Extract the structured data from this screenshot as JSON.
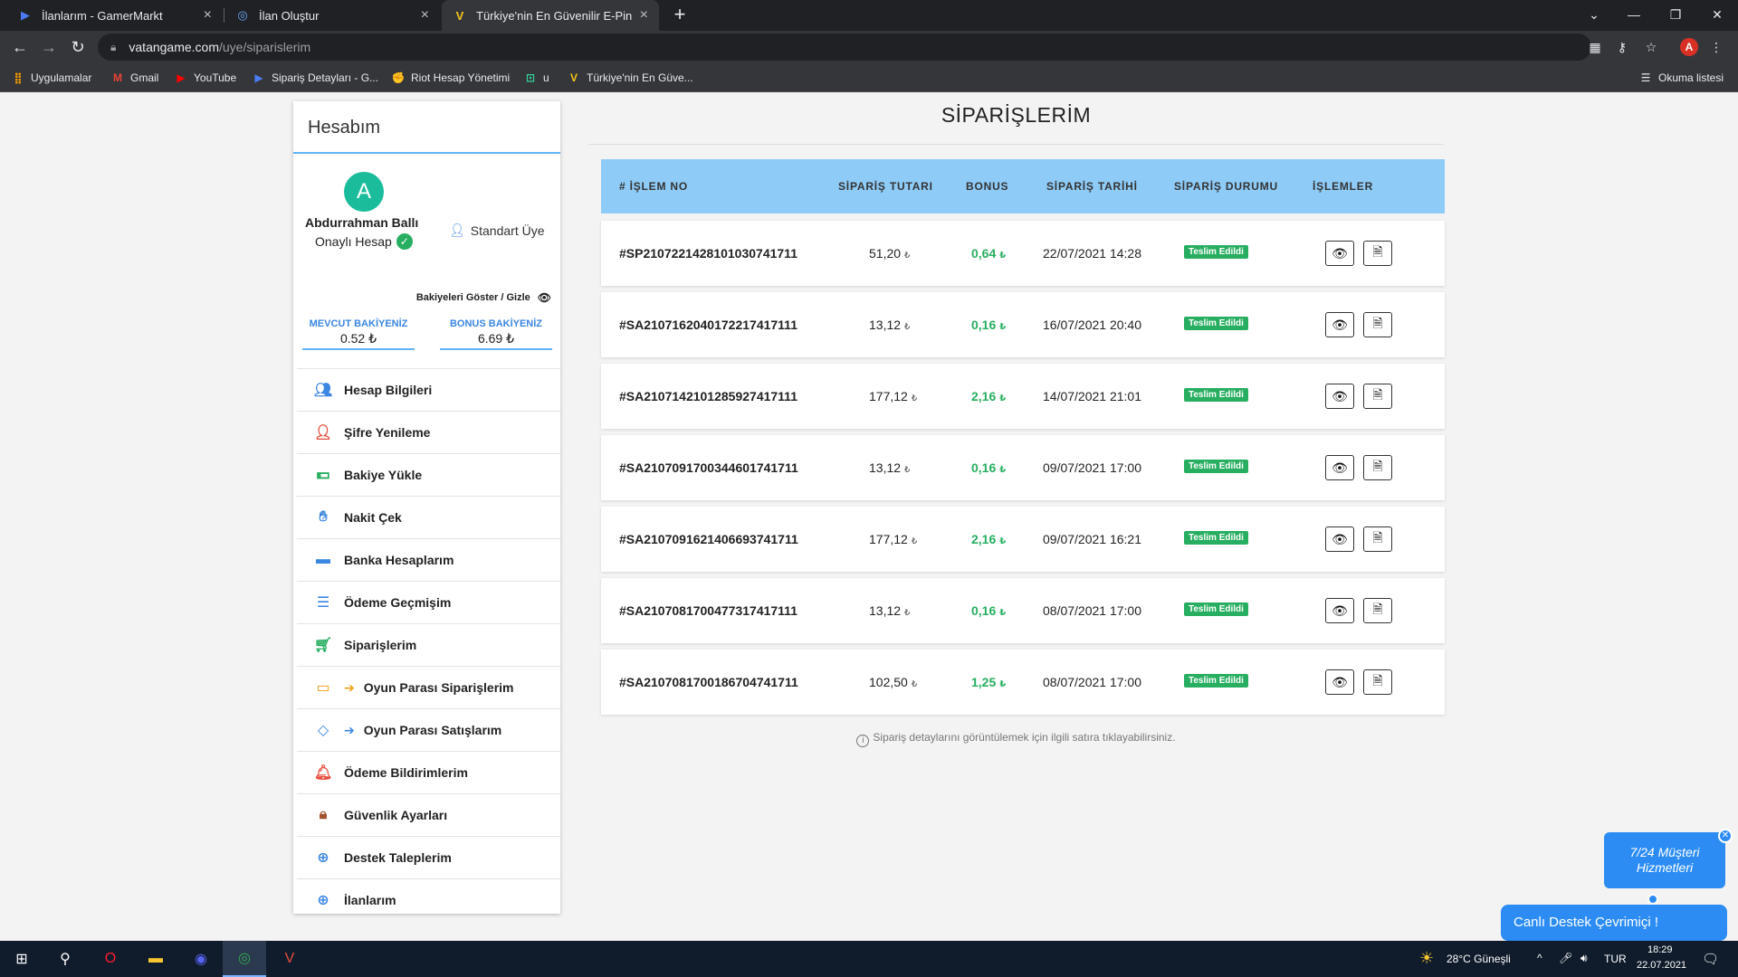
{
  "browser": {
    "tabs": [
      {
        "label": "İlanlarım - GamerMarkt",
        "icon": "gamermarkt-icon"
      },
      {
        "label": "İlan Oluştur",
        "icon": "ilan-icon"
      },
      {
        "label": "Türkiye'nin En Güvenilir E-Pin ve",
        "icon": "vatangame-icon"
      }
    ],
    "url_host": "vatangame.com",
    "url_path": "/uye/siparislerim",
    "profile_initial": "A",
    "bookmarks": [
      {
        "label": "Uygulamalar",
        "icon": "apps-grid-icon"
      },
      {
        "label": "Gmail",
        "icon": "gmail-icon"
      },
      {
        "label": "YouTube",
        "icon": "youtube-icon"
      },
      {
        "label": "Sipariş Detayları - G...",
        "icon": "gamermarkt-icon"
      },
      {
        "label": "Riot Hesap Yönetimi",
        "icon": "riot-icon"
      },
      {
        "label": "u",
        "icon": "u-icon"
      },
      {
        "label": "Türkiye'nin En Güve...",
        "icon": "vatangame-icon"
      }
    ],
    "reading_list": "Okuma listesi"
  },
  "sidebar": {
    "title": "Hesabım",
    "avatar_initial": "A",
    "user_name": "Abdurrahman Ballı",
    "verified_label": "Onaylı Hesap",
    "member_type": "Standart Üye",
    "toggle_balances": "Bakiyeleri Göster / Gizle",
    "balance_label": "MEVCUT BAKİYENİZ",
    "balance_value": "0.52 ₺",
    "bonus_label": "BONUS BAKİYENİZ",
    "bonus_value": "6.69 ₺",
    "menu": [
      {
        "label": "Hesap Bilgileri",
        "icon": "users-icon",
        "color": "#3a86e0"
      },
      {
        "label": "Şifre Yenileme",
        "icon": "user-lock-icon",
        "color": "#e74c3c"
      },
      {
        "label": "Bakiye Yükle",
        "icon": "money-icon",
        "color": "#27ae60"
      },
      {
        "label": "Nakit Çek",
        "icon": "hand-money-icon",
        "color": "#3a86e0"
      },
      {
        "label": "Banka Hesaplarım",
        "icon": "credit-card-icon",
        "color": "#3a86e0"
      },
      {
        "label": "Ödeme Geçmişim",
        "icon": "list-icon",
        "color": "#3a86e0"
      },
      {
        "label": "Siparişlerim",
        "icon": "cart-icon",
        "color": "#27ae60"
      },
      {
        "label": "Oyun Parası Siparişlerim",
        "icon": "coins-icon",
        "color": "#f39c12"
      },
      {
        "label": "Oyun Parası Satışlarım",
        "icon": "diamond-icon",
        "color": "#3a86e0"
      },
      {
        "label": "Ödeme Bildirimlerim",
        "icon": "bell-icon",
        "color": "#e74c3c"
      },
      {
        "label": "Güvenlik Ayarları",
        "icon": "lock-icon",
        "color": "#a0522d"
      },
      {
        "label": "Destek Taleplerim",
        "icon": "lifebuoy-icon",
        "color": "#3a86e0"
      },
      {
        "label": "İlanlarım",
        "icon": "lifebuoy-icon",
        "color": "#3a86e0"
      }
    ]
  },
  "main": {
    "title": "SİPARİŞLERİM",
    "columns": [
      "# İŞLEM NO",
      "SİPARİŞ TUTARI",
      "BONUS",
      "SİPARİŞ TARİHİ",
      "SİPARİŞ DURUMU",
      "İŞLEMLER"
    ],
    "currency": "₺",
    "orders": [
      {
        "no": "#SP2107221428101030741711",
        "amount": "51,20",
        "bonus": "0,64",
        "date": "22/07/2021 14:28",
        "status": "Teslim Edildi"
      },
      {
        "no": "#SA2107162040172217417111",
        "amount": "13,12",
        "bonus": "0,16",
        "date": "16/07/2021 20:40",
        "status": "Teslim Edildi"
      },
      {
        "no": "#SA2107142101285927417111",
        "amount": "177,12",
        "bonus": "2,16",
        "date": "14/07/2021 21:01",
        "status": "Teslim Edildi"
      },
      {
        "no": "#SA2107091700344601741711",
        "amount": "13,12",
        "bonus": "0,16",
        "date": "09/07/2021 17:00",
        "status": "Teslim Edildi"
      },
      {
        "no": "#SA2107091621406693741711",
        "amount": "177,12",
        "bonus": "2,16",
        "date": "09/07/2021 16:21",
        "status": "Teslim Edildi"
      },
      {
        "no": "#SA2107081700477317417111",
        "amount": "13,12",
        "bonus": "0,16",
        "date": "08/07/2021 17:00",
        "status": "Teslim Edildi"
      },
      {
        "no": "#SA2107081700186704741711",
        "amount": "102,50",
        "bonus": "1,25",
        "date": "08/07/2021 17:00",
        "status": "Teslim Edildi"
      }
    ],
    "hint": "Sipariş detaylarını görüntülemek için ilgili satıra tıklayabilirsiniz."
  },
  "chat": {
    "bubble": "7/24 Müşteri Hizmetleri",
    "button": "Canlı Destek Çevrimiçi !"
  },
  "taskbar": {
    "weather": "28°C  Güneşli",
    "lang": "TUR",
    "time": "18:29",
    "date": "22.07.2021"
  }
}
